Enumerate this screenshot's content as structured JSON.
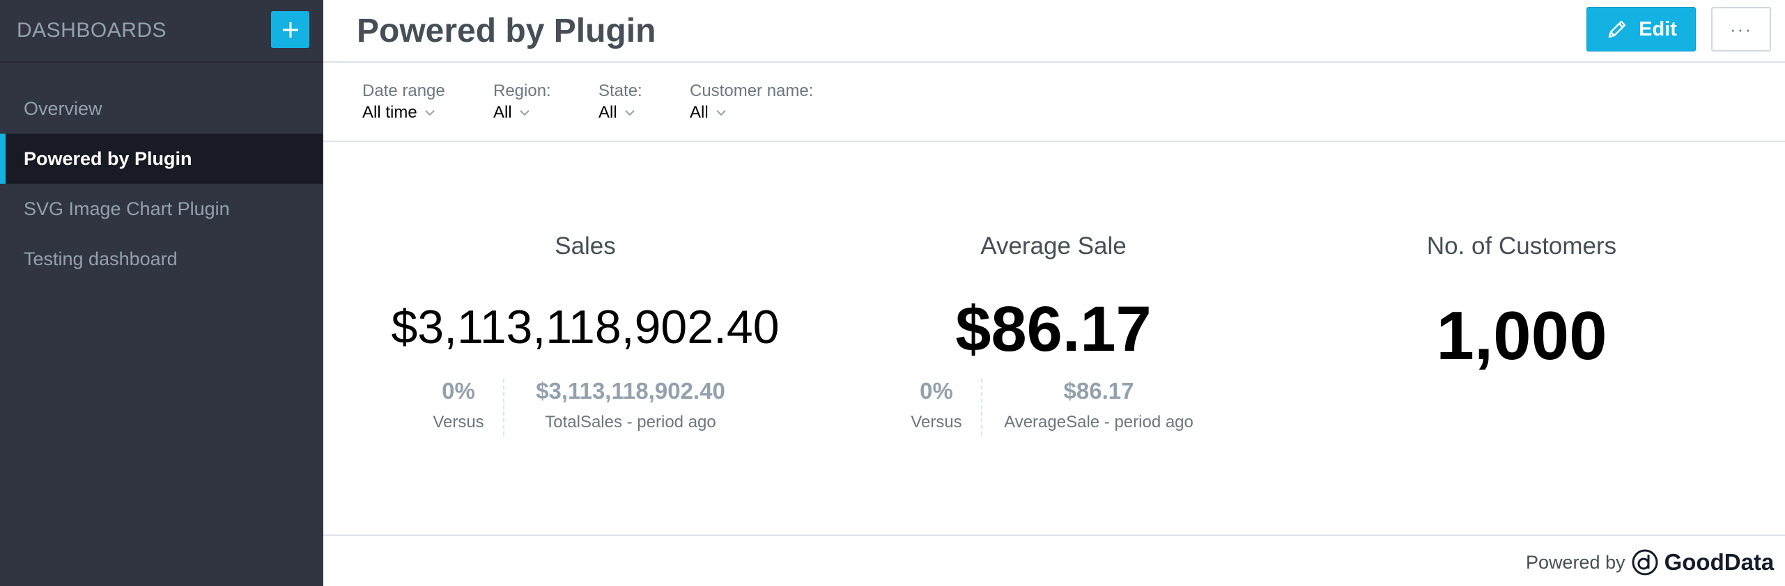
{
  "sidebar": {
    "title": "DASHBOARDS",
    "items": [
      {
        "label": "Overview"
      },
      {
        "label": "Powered by Plugin"
      },
      {
        "label": "SVG Image Chart Plugin"
      },
      {
        "label": "Testing dashboard"
      }
    ],
    "active_index": 1
  },
  "header": {
    "title": "Powered by Plugin",
    "edit_label": "Edit",
    "more_label": "···"
  },
  "filters": [
    {
      "label": "Date range",
      "value": "All time"
    },
    {
      "label": "Region:",
      "value": "All"
    },
    {
      "label": "State:",
      "value": "All"
    },
    {
      "label": "Customer name:",
      "value": "All"
    }
  ],
  "kpis": [
    {
      "title": "Sales",
      "value": "$3,113,118,902.40",
      "compare": [
        {
          "value": "0%",
          "label": "Versus"
        },
        {
          "value": "$3,113,118,902.40",
          "label": "TotalSales - period ago"
        }
      ]
    },
    {
      "title": "Average Sale",
      "value": "$86.17",
      "compare": [
        {
          "value": "0%",
          "label": "Versus"
        },
        {
          "value": "$86.17",
          "label": "AverageSale - period ago"
        }
      ]
    },
    {
      "title": "No. of Customers",
      "value": "1,000"
    }
  ],
  "footer": {
    "powered_by": "Powered by",
    "brand": "GoodData"
  },
  "colors": {
    "accent": "#14b2e2",
    "sidebar_bg": "#313441",
    "sidebar_active_bg": "#191b24",
    "muted": "#94a1ad"
  }
}
